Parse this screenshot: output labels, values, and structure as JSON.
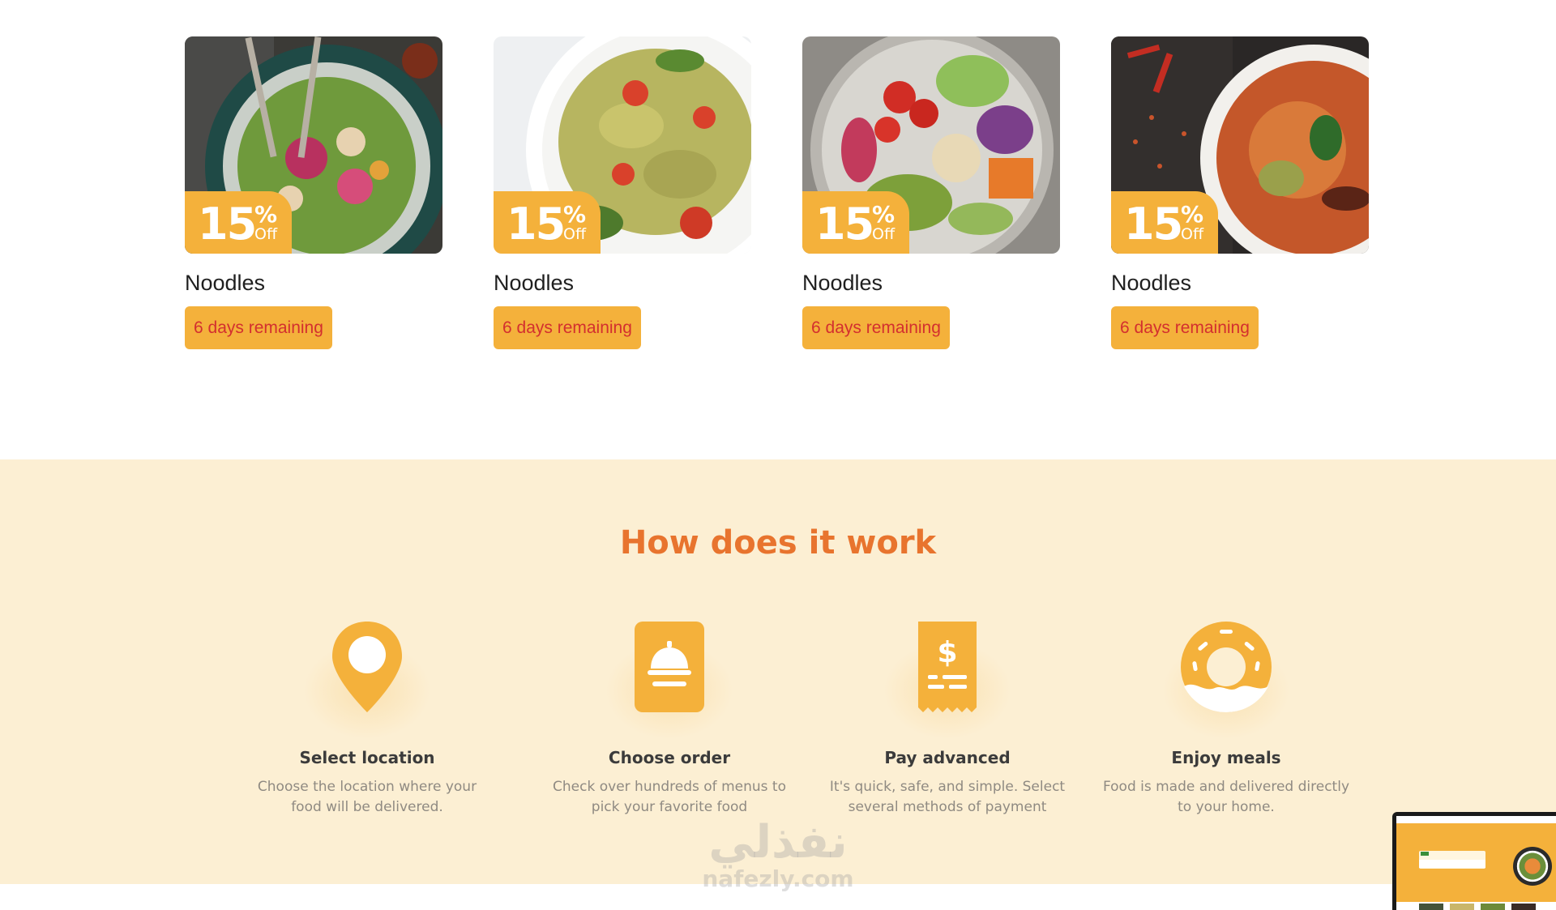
{
  "offers": [
    {
      "discount_number": "15",
      "discount_percent": "%",
      "discount_off": "Off",
      "title": "Noodles",
      "remaining": "6 days remaining",
      "image": "food-bowl-salad"
    },
    {
      "discount_number": "15",
      "discount_percent": "%",
      "discount_off": "Off",
      "title": "Noodles",
      "remaining": "6 days remaining",
      "image": "pasta-salad"
    },
    {
      "discount_number": "15",
      "discount_percent": "%",
      "discount_off": "Off",
      "title": "Noodles",
      "remaining": "6 days remaining",
      "image": "veggie-bowl"
    },
    {
      "discount_number": "15",
      "discount_percent": "%",
      "discount_off": "Off",
      "title": "Noodles",
      "remaining": "6 days remaining",
      "image": "curry-soup"
    }
  ],
  "how_it_works": {
    "title": "How does it work",
    "steps": [
      {
        "icon": "location-pin-icon",
        "title": "Select location",
        "description": "Choose the location where your food will be delivered."
      },
      {
        "icon": "food-cloche-icon",
        "title": "Choose order",
        "description": "Check over hundreds of menus to pick your favorite food"
      },
      {
        "icon": "receipt-dollar-icon",
        "title": "Pay advanced",
        "description": "It's quick, safe, and simple. Select several methods of payment"
      },
      {
        "icon": "donut-icon",
        "title": "Enjoy meals",
        "description": "Food is made and delivered directly to your home."
      }
    ]
  },
  "watermark": {
    "arabic": "نفذلي",
    "latin": "nafezly.com"
  },
  "colors": {
    "accent": "#f4b13b",
    "heading": "#e8742e",
    "section_bg": "#fcefd3",
    "remaining_text": "#d32f2f"
  }
}
